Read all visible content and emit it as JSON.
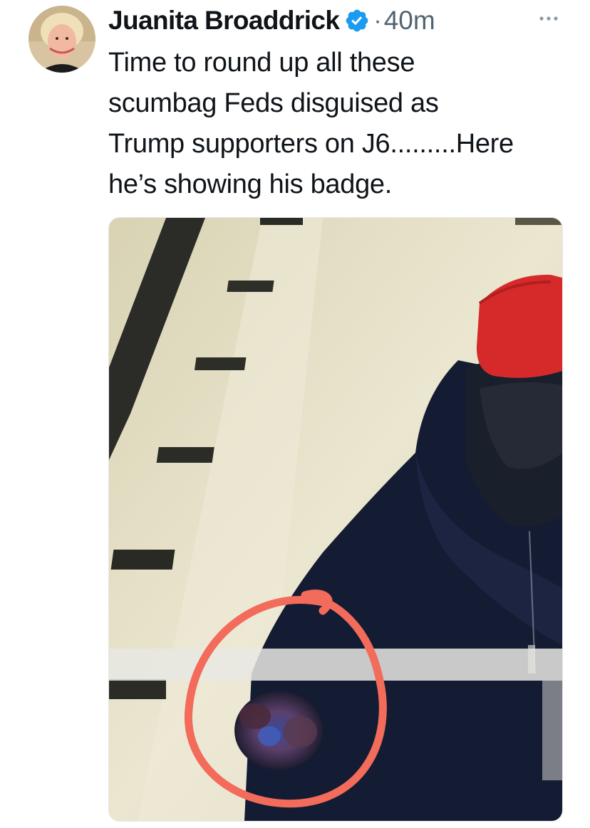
{
  "tweet": {
    "author_name": "Juanita Broaddrick",
    "separator": "·",
    "timestamp": "40m",
    "text_lines": [
      "Time to round up all these",
      "scumbag Feds disguised as",
      "Trump supporters on J6.........Here",
      "he’s showing his badge."
    ]
  },
  "icons": {
    "verified": "verified-badge-icon",
    "more": "more-options-icon"
  },
  "colors": {
    "verified_blue": "#1d9bf0",
    "secondary_text": "#536471",
    "circle_annotation": "#f26b5b",
    "hat_red": "#d62a2a",
    "jacket_navy": "#141c33"
  }
}
